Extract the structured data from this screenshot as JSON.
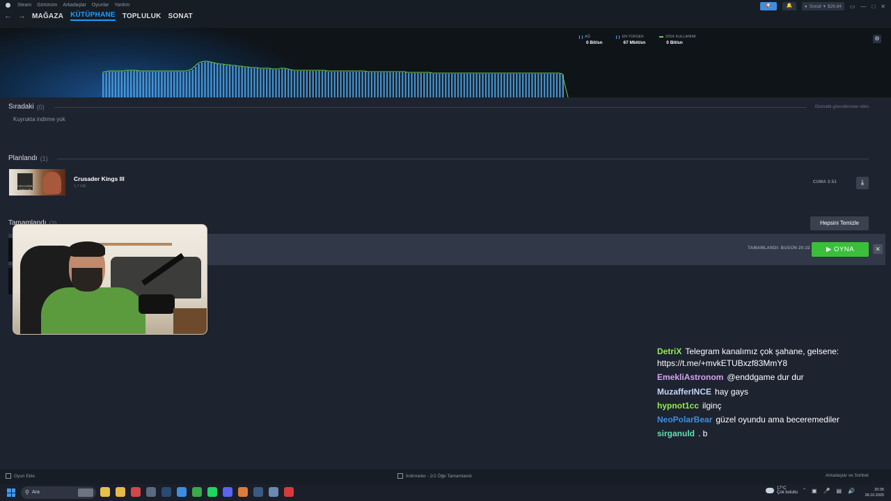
{
  "menu": {
    "steam": "Steam",
    "items": [
      "Görünüm",
      "Arkadaşlar",
      "Oyunlar",
      "Yardım"
    ]
  },
  "nav": {
    "links": [
      "MAĞAZA",
      "KÜTÜPHANE",
      "TOPLULUK",
      "SONAT"
    ],
    "active": "KÜTÜPHANE"
  },
  "account": {
    "name": "Sonat",
    "wallet": "$26.84"
  },
  "stats": {
    "network_label": "AĞ",
    "network_value": "0 Bit/sn",
    "peak_label": "EN YÜKSEK",
    "peak_value": "67 Mbit/sn",
    "disk_label": "DİSK KULLANIMI",
    "disk_value": "0 Bit/sn"
  },
  "colors": {
    "accent": "#1a9fff",
    "play_green": "#3bbf3b",
    "disk_line": "#6dd34f",
    "network_bars": "#4fa3e8"
  },
  "queue": {
    "title": "Sıradaki",
    "count": "(0)",
    "empty": "Kuyrukta indirme yok",
    "auto_updates": "Otomatik güncellemeler etkin"
  },
  "scheduled": {
    "title": "Planlandı",
    "count": "(1)",
    "game": {
      "name": "Crusader Kings III",
      "size": "1,7 GB",
      "time": "CUMA 3:51",
      "cover_text": "CRUSADER KINGS III"
    }
  },
  "completed": {
    "title": "Tamamlandı",
    "count": "(2)",
    "clear_all": "Hepsini Temizle",
    "status": "TAMAMLANDI: BUGÜN 20:32",
    "play": "OYNA"
  },
  "chat": {
    "partial": {
      "user": "DetriX",
      "text": "Telegram kanalımız çok şahane, gelsene:"
    },
    "partial_cont": "https://t.me/+mvkETUBxzf83MmY8",
    "messages": [
      {
        "user": "EmekliAstronom",
        "text": "@enddgame dur dur",
        "color": "#d9a1f0"
      },
      {
        "user": "MuzafferINCE",
        "text": "hay gays",
        "color": "#c6d4f5"
      },
      {
        "user": "hypnot1cc",
        "text": "ilginç",
        "color": "#8ef04f"
      },
      {
        "user": "NeoPolarBear",
        "text": "güzel oyundu ama beceremediler",
        "color": "#3d8ee0"
      },
      {
        "user": "sirganuld",
        "text": ". b",
        "color": "#5fe0b0"
      }
    ]
  },
  "footer": {
    "add_game": "Oyun Ekle",
    "downloads": "İndirmeler - 2/2 Öğe Tamamlandı",
    "friends": "Arkadaşlar ve Sohbet"
  },
  "taskbar": {
    "search": "Ara",
    "weather_temp": "17°C",
    "weather_desc": "Çok bulutlu",
    "time": "20:35",
    "date": "28.10.2025"
  },
  "graph": {
    "bar_count": 150,
    "profile": [
      0.35,
      0.36,
      0.37,
      0.37,
      0.37,
      0.37,
      0.37,
      0.37,
      0.38,
      0.38,
      0.38,
      0.38,
      0.37,
      0.37,
      0.37,
      0.37,
      0.37,
      0.37,
      0.37,
      0.37,
      0.37,
      0.37,
      0.37,
      0.37,
      0.37,
      0.37,
      0.37,
      0.37,
      0.38,
      0.4,
      0.44,
      0.48,
      0.5,
      0.51,
      0.51,
      0.5,
      0.49,
      0.48,
      0.47,
      0.47,
      0.46,
      0.46,
      0.45,
      0.45,
      0.44,
      0.44,
      0.43,
      0.43,
      0.42,
      0.42,
      0.42,
      0.41,
      0.41,
      0.41,
      0.41,
      0.4,
      0.4,
      0.4,
      0.41,
      0.41,
      0.4,
      0.39,
      0.38,
      0.38,
      0.38,
      0.38,
      0.38,
      0.38,
      0.38,
      0.38,
      0.38,
      0.38,
      0.38,
      0.37,
      0.37,
      0.37,
      0.37,
      0.37,
      0.37,
      0.37,
      0.37,
      0.37,
      0.37,
      0.37,
      0.37,
      0.37,
      0.36,
      0.36,
      0.36,
      0.36,
      0.36,
      0.36,
      0.36,
      0.36,
      0.36,
      0.36,
      0.36,
      0.36,
      0.36,
      0.35,
      0.35,
      0.35,
      0.35,
      0.35,
      0.35,
      0.35,
      0.35,
      0.34,
      0.34,
      0.34,
      0.34,
      0.34,
      0.34,
      0.34,
      0.34,
      0.34,
      0.34,
      0.34,
      0.34,
      0.34,
      0.34,
      0.34,
      0.34,
      0.34,
      0.34,
      0.34,
      0.34,
      0.34,
      0.34,
      0.34,
      0.34,
      0.34,
      0.34,
      0.34,
      0.34,
      0.34,
      0.34,
      0.34,
      0.34,
      0.34,
      0.34,
      0.34,
      0.34,
      0.34,
      0.34,
      0.34,
      0.34,
      0.34,
      0.34,
      0.33
    ]
  }
}
